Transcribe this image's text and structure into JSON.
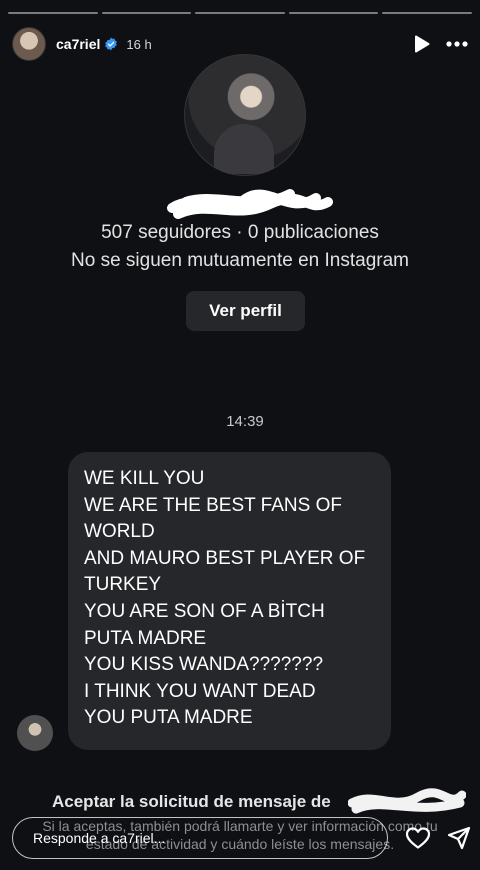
{
  "story": {
    "username": "ca7riel",
    "time_ago": "16 h",
    "icons": {
      "verified": "verified-badge-icon",
      "play": "play-icon",
      "more": "more-icon"
    }
  },
  "profile_card": {
    "stats": "507 seguidores · 0 publicaciones",
    "mutual_text": "No se siguen mutuamente en Instagram",
    "view_profile_label": "Ver perfil"
  },
  "chat": {
    "timestamp": "14:39",
    "message_lines": [
      "WE KILL YOU",
      "WE ARE THE BEST FANS OF",
      "WORLD",
      "AND MAURO BEST PLAYER OF",
      "TURKEY",
      "YOU ARE SON OF A BİTCH",
      "PUTA MADRE",
      "YOU KISS WANDA???????",
      "I THINK YOU WANT DEAD",
      "YOU PUTA MADRE"
    ]
  },
  "request": {
    "title": "Aceptar la solicitud de mensaje de",
    "description": "Si la aceptas, también podrá llamarte y ver información como tu estado de actividad y cuándo leíste los mensajes."
  },
  "reply_bar": {
    "placeholder": "Responde a ca7riel...",
    "icons": {
      "like": "heart-icon",
      "send": "send-icon"
    }
  }
}
